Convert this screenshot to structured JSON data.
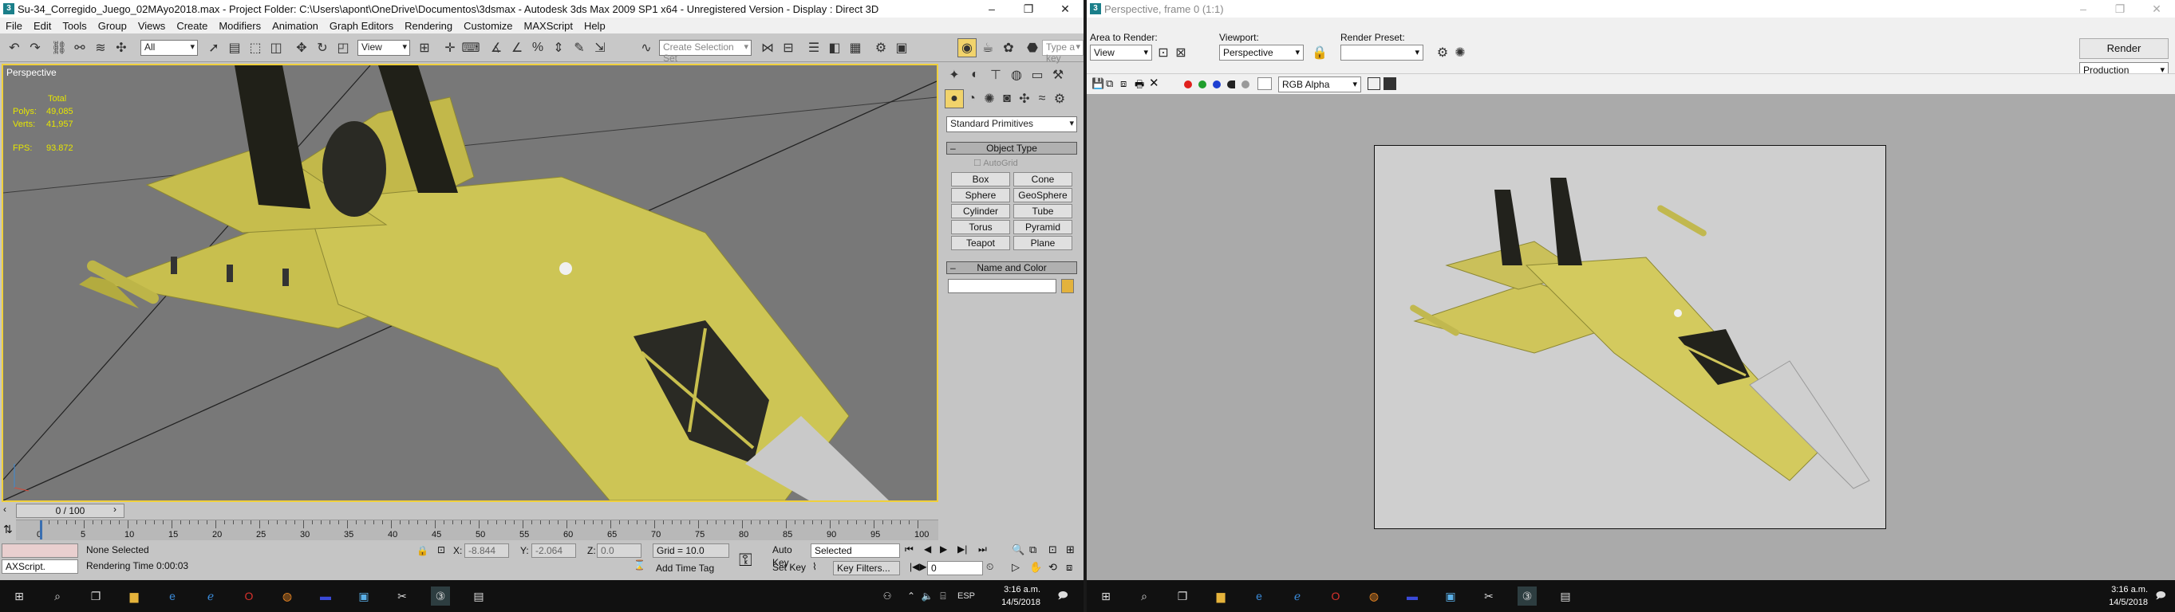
{
  "max": {
    "title": "Su-34_Corregido_Juego_02MAyo2018.max    - Project Folder: C:\\Users\\apont\\OneDrive\\Documentos\\3dsmax    - Autodesk 3ds Max  2009 SP1  x64    - Unregistered Version    - Display : Direct 3D",
    "menu": [
      "File",
      "Edit",
      "Tools",
      "Group",
      "Views",
      "Create",
      "Modifiers",
      "Animation",
      "Graph Editors",
      "Rendering",
      "Customize",
      "MAXScript",
      "Help"
    ],
    "toolbar": {
      "filter": "All",
      "ref_coord": "View",
      "selection_set_placeholder": "Create Selection Set",
      "search_placeholder": "Type a key"
    },
    "viewport": {
      "label": "Perspective",
      "stats": {
        "header": "Total",
        "polys_label": "Polys:",
        "polys": "49,085",
        "verts_label": "Verts:",
        "verts": "41,957",
        "fps_label": "FPS:",
        "fps": "93.872"
      }
    },
    "command_panel": {
      "category": "Standard Primitives",
      "object_type_title": "Object Type",
      "autogrid": "AutoGrid",
      "buttons": [
        "Box",
        "Cone",
        "Sphere",
        "GeoSphere",
        "Cylinder",
        "Tube",
        "Torus",
        "Pyramid",
        "Teapot",
        "Plane"
      ],
      "name_color_title": "Name and Color",
      "object_color": "#e3b23c"
    },
    "timeline": {
      "frame_slider": "0 / 100",
      "current_frame": 0,
      "ticks": [
        "0",
        "5",
        "10",
        "15",
        "20",
        "25",
        "30",
        "35",
        "40",
        "45",
        "50",
        "55",
        "60",
        "65",
        "70",
        "75",
        "80",
        "85",
        "90",
        "95",
        "100"
      ]
    },
    "status": {
      "maxscript": "AXScript.",
      "selection": "None Selected",
      "prompt": "Rendering Time  0:00:03",
      "x_label": "X:",
      "x": "-8.844",
      "y_label": "Y:",
      "y": "-2.064",
      "z_label": "Z:",
      "z": "0.0",
      "grid": "Grid = 10.0",
      "add_time_tag": "Add Time Tag",
      "auto_key": "Auto Key",
      "set_key": "Set Key",
      "key_mode": "Selected",
      "key_filters": "Key Filters...",
      "frame": "0"
    }
  },
  "render_frame": {
    "title": "Perspective, frame 0 (1:1)",
    "area_label": "Area to Render:",
    "area_value": "View",
    "viewport_label": "Viewport:",
    "viewport_value": "Perspective",
    "preset_label": "Render Preset:",
    "preset_value": "",
    "render_button": "Render",
    "mode": "Production",
    "channel": "RGB Alpha",
    "channel_colors": [
      "#e0201c",
      "#1f9e2c",
      "#1d3fd1",
      "#222222",
      "#9a9a9a"
    ]
  },
  "taskbar": {
    "lang": "ESP",
    "time": "3:16 a.m.",
    "date": "14/5/2018",
    "icons": [
      "windows-icon",
      "search-icon",
      "task-view-icon",
      "file-explorer-icon",
      "edge-icon",
      "ie-icon",
      "opera-icon",
      "firefox-icon",
      "amd-icon",
      "photos-icon",
      "snipping-icon",
      "3dsmax-icon",
      "render-icon"
    ]
  }
}
